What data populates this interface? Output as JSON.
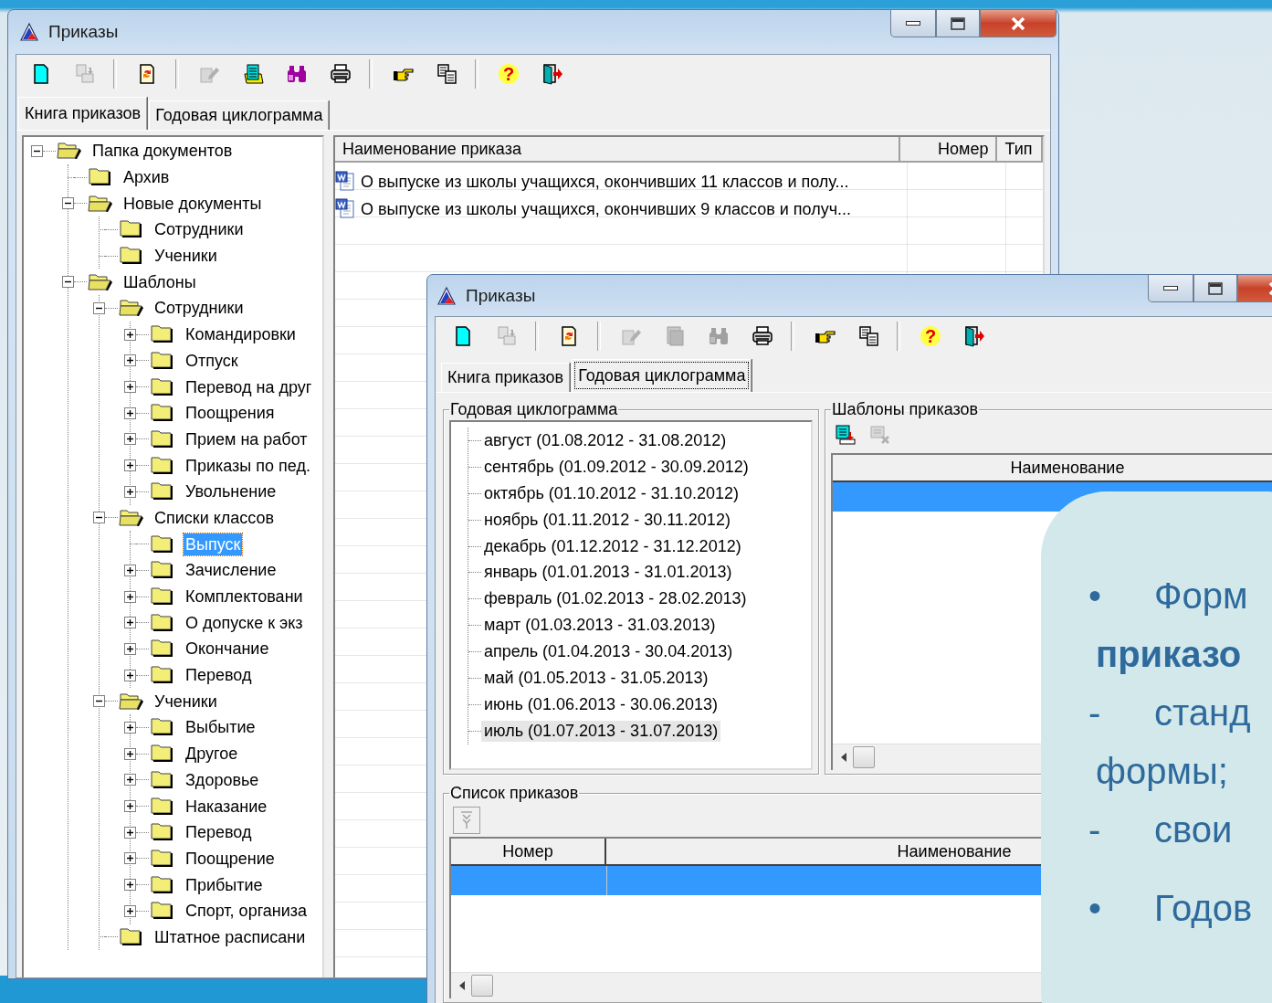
{
  "back_window": {
    "title": "Приказы",
    "toolbar": [
      {
        "kind": "new",
        "disabled": false
      },
      {
        "kind": "copy",
        "disabled": true
      },
      {
        "kind": "separator"
      },
      {
        "kind": "refresh",
        "disabled": false
      },
      {
        "kind": "separator"
      },
      {
        "kind": "edit",
        "disabled": true
      },
      {
        "kind": "list",
        "disabled": false
      },
      {
        "kind": "find",
        "disabled": false
      },
      {
        "kind": "print",
        "disabled": false
      },
      {
        "kind": "separator"
      },
      {
        "kind": "point",
        "disabled": false
      },
      {
        "kind": "swap",
        "disabled": false
      },
      {
        "kind": "separator"
      },
      {
        "kind": "help",
        "disabled": false,
        "glyph": "?"
      },
      {
        "kind": "exit",
        "disabled": false
      }
    ],
    "tabs": [
      {
        "label": "Книга приказов",
        "selected": true
      },
      {
        "label": "Годовая циклограмма",
        "selected": false
      }
    ],
    "tree": [
      {
        "label": "Папка документов",
        "expanded": true,
        "selected": false,
        "children": [
          {
            "label": "Архив",
            "selected": false
          },
          {
            "label": "Новые документы",
            "expanded": true,
            "selected": false,
            "children": [
              {
                "label": "Сотрудники",
                "selected": false
              },
              {
                "label": "Ученики",
                "selected": false
              }
            ]
          },
          {
            "label": "Шаблоны",
            "expanded": true,
            "selected": false,
            "children": [
              {
                "label": "Сотрудники",
                "expanded": true,
                "selected": false,
                "children": [
                  {
                    "label": "Командировки",
                    "expanded": false,
                    "selected": false
                  },
                  {
                    "label": "Отпуск",
                    "expanded": false,
                    "selected": false
                  },
                  {
                    "label": "Перевод на друг",
                    "expanded": false,
                    "selected": false
                  },
                  {
                    "label": "Поощрения",
                    "expanded": false,
                    "selected": false
                  },
                  {
                    "label": "Прием на работ",
                    "expanded": false,
                    "selected": false
                  },
                  {
                    "label": "Приказы по пед.",
                    "expanded": false,
                    "selected": false
                  },
                  {
                    "label": "Увольнение",
                    "expanded": false,
                    "selected": false
                  }
                ]
              },
              {
                "label": "Списки классов",
                "expanded": true,
                "selected": false,
                "children": [
                  {
                    "label": "Выпуск",
                    "selected": true
                  },
                  {
                    "label": "Зачисление",
                    "expanded": false,
                    "selected": false
                  },
                  {
                    "label": "Комплектовани",
                    "expanded": false,
                    "selected": false
                  },
                  {
                    "label": "О допуске к экз",
                    "expanded": false,
                    "selected": false
                  },
                  {
                    "label": "Окончание",
                    "expanded": false,
                    "selected": false
                  },
                  {
                    "label": "Перевод",
                    "expanded": false,
                    "selected": false
                  }
                ]
              },
              {
                "label": "Ученики",
                "expanded": true,
                "selected": false,
                "children": [
                  {
                    "label": "Выбытие",
                    "expanded": false,
                    "selected": false
                  },
                  {
                    "label": "Другое",
                    "expanded": false,
                    "selected": false
                  },
                  {
                    "label": "Здоровье",
                    "expanded": false,
                    "selected": false
                  },
                  {
                    "label": "Наказание",
                    "expanded": false,
                    "selected": false
                  },
                  {
                    "label": "Перевод",
                    "expanded": false,
                    "selected": false
                  },
                  {
                    "label": "Поощрение",
                    "expanded": false,
                    "selected": false
                  },
                  {
                    "label": "Прибытие",
                    "expanded": false,
                    "selected": false
                  },
                  {
                    "label": "Спорт, организа",
                    "expanded": false,
                    "selected": false
                  }
                ]
              },
              {
                "label": "Штатное расписани",
                "selected": false
              }
            ]
          }
        ]
      }
    ],
    "orders_table": {
      "columns": [
        "Наименование приказа",
        "Номер",
        "Тип"
      ],
      "rows": [
        {
          "name": "О выпуске из школы учащихся, окончивших 11 классов и полу..."
        },
        {
          "name": "О выпуске из школы учащихся, окончивших 9 классов и получ..."
        }
      ]
    }
  },
  "front_window": {
    "title": "Приказы",
    "toolbar": [
      {
        "kind": "new",
        "disabled": false
      },
      {
        "kind": "copy",
        "disabled": true
      },
      {
        "kind": "separator"
      },
      {
        "kind": "refresh",
        "disabled": false
      },
      {
        "kind": "separator"
      },
      {
        "kind": "edit",
        "disabled": true
      },
      {
        "kind": "list",
        "disabled": true
      },
      {
        "kind": "find",
        "disabled": true
      },
      {
        "kind": "print",
        "disabled": false
      },
      {
        "kind": "separator"
      },
      {
        "kind": "point",
        "disabled": false
      },
      {
        "kind": "swap",
        "disabled": false
      },
      {
        "kind": "separator"
      },
      {
        "kind": "help",
        "disabled": false,
        "glyph": "?"
      },
      {
        "kind": "exit",
        "disabled": false
      }
    ],
    "tabs": [
      {
        "label": "Книга приказов",
        "selected": false
      },
      {
        "label": "Годовая циклограмма",
        "selected": true
      }
    ],
    "cyclogram": {
      "title": "Годовая циклограмма",
      "months": [
        {
          "label": "август (01.08.2012 - 31.08.2012)",
          "selected": false
        },
        {
          "label": "сентябрь (01.09.2012 - 30.09.2012)",
          "selected": false
        },
        {
          "label": "октябрь (01.10.2012 - 31.10.2012)",
          "selected": false
        },
        {
          "label": "ноябрь (01.11.2012 - 30.11.2012)",
          "selected": false
        },
        {
          "label": "декабрь (01.12.2012 - 31.12.2012)",
          "selected": false
        },
        {
          "label": "январь (01.01.2013 - 31.01.2013)",
          "selected": false
        },
        {
          "label": "февраль (01.02.2013 - 28.02.2013)",
          "selected": false
        },
        {
          "label": "март (01.03.2013 - 31.03.2013)",
          "selected": false
        },
        {
          "label": "апрель (01.04.2013 - 30.04.2013)",
          "selected": false
        },
        {
          "label": "май (01.05.2013 - 31.05.2013)",
          "selected": false
        },
        {
          "label": "июнь (01.06.2013 - 30.06.2013)",
          "selected": false
        },
        {
          "label": "июль (01.07.2013 - 31.07.2013)",
          "selected": true
        }
      ]
    },
    "templates": {
      "title": "Шаблоны приказов",
      "toolbar": [
        {
          "kind": "add",
          "disabled": false
        },
        {
          "kind": "remove",
          "disabled": true
        }
      ],
      "columns": [
        "Наименование"
      ],
      "rows": [
        {
          "selected": true
        }
      ]
    },
    "orders_list": {
      "title": "Список приказов",
      "toolbar": [
        {
          "kind": "move_down",
          "disabled": true
        }
      ],
      "columns": [
        "Номер",
        "Наименование"
      ],
      "rows": [
        {
          "selected": true
        }
      ]
    }
  },
  "callout": {
    "paragraphs": [
      [
        {
          "marker": "•",
          "text": "Форм",
          "bold": false
        },
        {
          "text": "приказо",
          "bold": true
        },
        {
          "marker": "-",
          "text": "станд",
          "bold": false
        },
        {
          "text": "формы;",
          "bold": false
        },
        {
          "marker": "-",
          "text": "свои",
          "bold": false
        }
      ],
      [
        {
          "marker": "•",
          "text": "Годов",
          "bold": false
        }
      ]
    ]
  }
}
